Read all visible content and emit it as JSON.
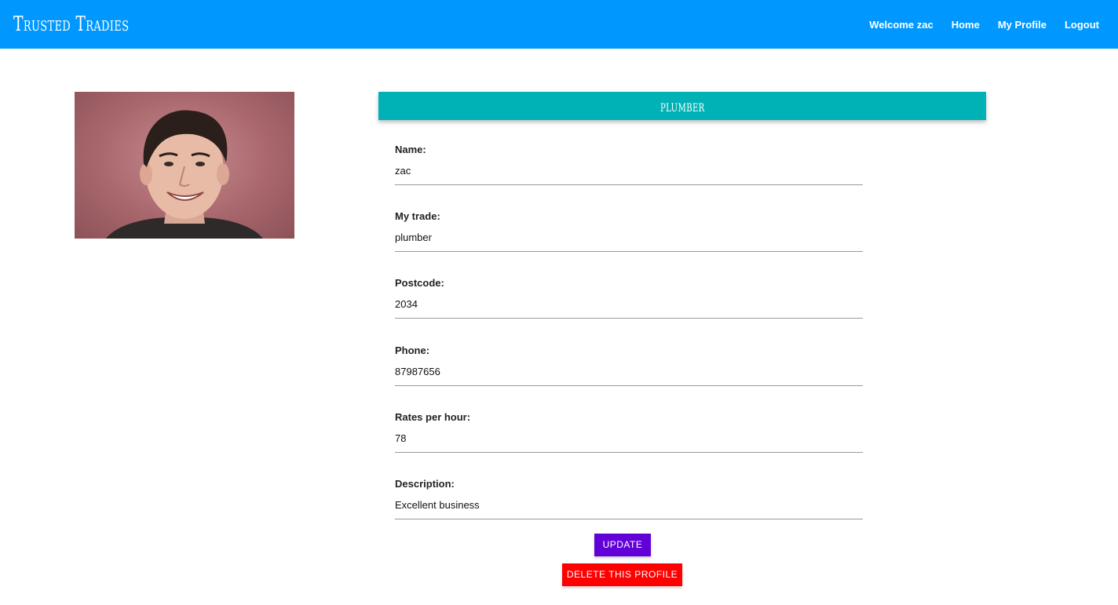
{
  "header": {
    "brand": "Trusted Tradies",
    "welcome": "Welcome zac",
    "nav": {
      "home": "Home",
      "profile": "My Profile",
      "logout": "Logout"
    }
  },
  "profile": {
    "trade_title": "plumber",
    "fields": [
      {
        "label": "Name:",
        "value": "zac"
      },
      {
        "label": "My trade:",
        "value": "plumber"
      },
      {
        "label": "Postcode:",
        "value": "2034"
      },
      {
        "label": "Phone:",
        "value": "87987656"
      },
      {
        "label": "Rates per hour:",
        "value": "78"
      },
      {
        "label": "Description:",
        "value": "Excellent business"
      }
    ]
  },
  "actions": {
    "update": "UPDATE",
    "delete": "DELETE THIS PROFILE"
  },
  "colors": {
    "navbar": "#0098ff",
    "trade_header": "#00b2b6",
    "update_button": "#6200d8",
    "delete_button": "#ff0000"
  }
}
